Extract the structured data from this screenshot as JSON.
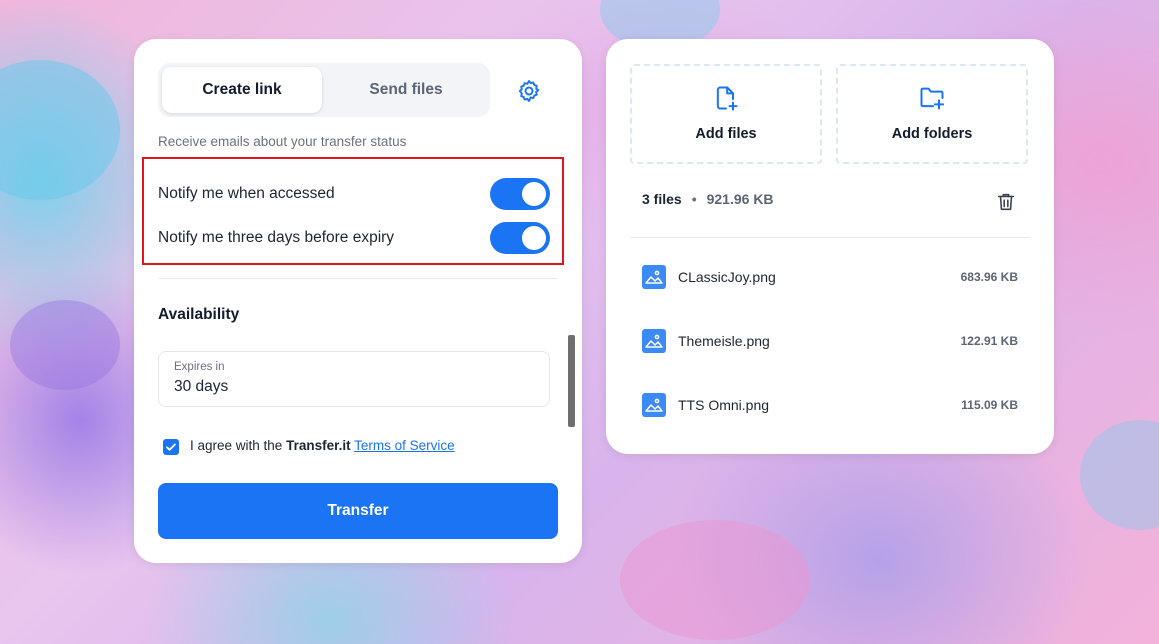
{
  "colors": {
    "accent": "#1b74f4",
    "highlight_border": "#e3141b",
    "card_bg": "#ffffff"
  },
  "tabs": [
    {
      "label": "Create link",
      "active": true
    },
    {
      "label": "Send files",
      "active": false
    }
  ],
  "settings_icon": "gear-icon",
  "notifications": {
    "label": "Receive emails about your transfer status",
    "items": [
      {
        "label": "Notify me when accessed",
        "enabled": true
      },
      {
        "label": "Notify me three days before expiry",
        "enabled": true
      }
    ]
  },
  "availability": {
    "title": "Availability",
    "expires_label": "Expires in",
    "expires_value": "30 days"
  },
  "agreement": {
    "checked": true,
    "prefix": "I agree with the ",
    "brand": "Transfer.it",
    "space": " ",
    "link": "Terms of Service"
  },
  "transfer_button": "Transfer",
  "drop_zones": [
    {
      "label": "Add files",
      "icon": "file-plus-icon"
    },
    {
      "label": "Add folders",
      "icon": "folder-plus-icon"
    }
  ],
  "summary": {
    "count": "3 files",
    "separator": "•",
    "total_size": "921.96 KB"
  },
  "trash_icon": "trash-icon",
  "files": [
    {
      "name": "CLassicJoy.png",
      "size": "683.96 KB",
      "icon": "image-file-icon"
    },
    {
      "name": "Themeisle.png",
      "size": "122.91 KB",
      "icon": "image-file-icon"
    },
    {
      "name": "TTS Omni.png",
      "size": "115.09 KB",
      "icon": "image-file-icon"
    }
  ]
}
